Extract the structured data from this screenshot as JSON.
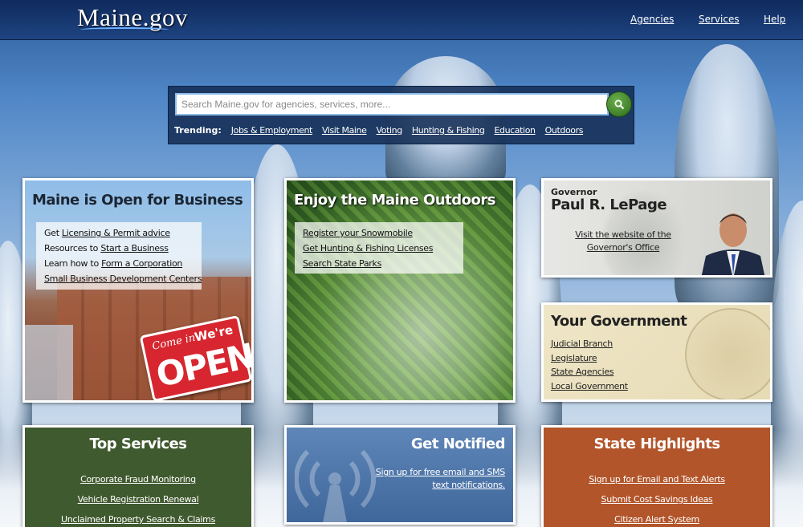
{
  "header": {
    "logo": "Maine.gov",
    "nav": [
      "Agencies",
      "Services",
      "Help"
    ]
  },
  "search": {
    "placeholder": "Search Maine.gov for agencies, services, more...",
    "trending_label": "Trending:",
    "trending": [
      "Jobs & Employment",
      "Visit Maine",
      "Voting",
      "Hunting & Fishing",
      "Education",
      "Outdoors"
    ]
  },
  "business": {
    "title": "Maine is Open for Business",
    "rows": [
      {
        "prefix": "Get ",
        "link": "Licensing & Permit advice"
      },
      {
        "prefix": "Resources to ",
        "link": "Start a Business"
      },
      {
        "prefix": "Learn how to ",
        "link": "Form a Corporation"
      },
      {
        "prefix": "",
        "link": "Small Business Development Centers"
      }
    ],
    "sign": {
      "come_in": "Come in",
      "were": "We're",
      "open": "OPEN"
    }
  },
  "outdoors": {
    "title": "Enjoy the Maine Outdoors",
    "links": [
      "Register your Snowmobile",
      "Get Hunting & Fishing Licenses",
      "Search State Parks"
    ]
  },
  "governor": {
    "label": "Governor",
    "name": "Paul R. LePage",
    "link": "Visit the website of the Governor's Office"
  },
  "your_government": {
    "title": "Your Government",
    "links": [
      "Judicial Branch",
      "Legislature",
      "State Agencies",
      "Local Government"
    ]
  },
  "top_services": {
    "title": "Top Services",
    "links": [
      "Corporate Fraud Monitoring",
      "Vehicle Registration Renewal",
      "Unclaimed Property Search & Claims"
    ]
  },
  "get_notified": {
    "title": "Get Notified",
    "link": "Sign up for free email and SMS text notifications."
  },
  "state_highlights": {
    "title": "State Highlights",
    "links": [
      "Sign up for Email and Text Alerts",
      "Submit Cost Savings Ideas",
      "Citizen Alert System"
    ]
  },
  "icons": {
    "search": "magnifier-icon",
    "signal": "broadcast-tower-icon"
  },
  "colors": {
    "header": "#1e4482",
    "top_services": "#405a2f",
    "get_notified": "#3f679b",
    "state_highlights": "#b2552a",
    "search_button": "#2d6a1c"
  }
}
